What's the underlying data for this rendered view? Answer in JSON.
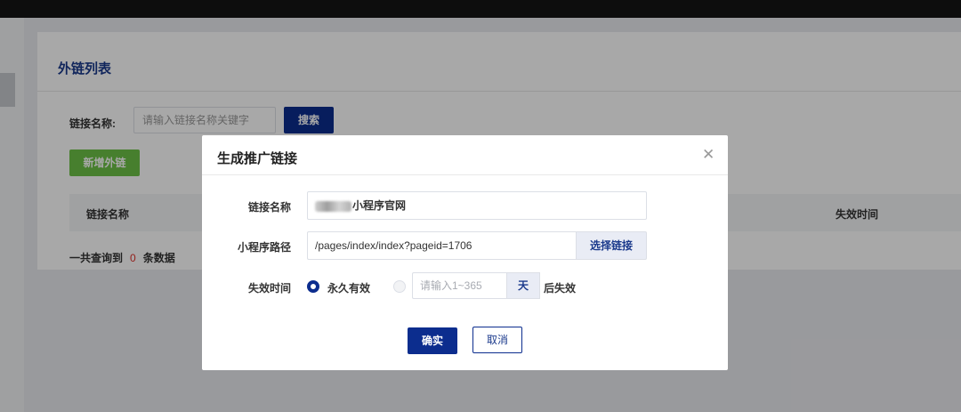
{
  "page": {
    "title": "外链列表",
    "search": {
      "label": "链接名称:",
      "placeholder": "请输入链接名称关键字",
      "button": "搜索"
    },
    "add_button": "新增外链",
    "table": {
      "columns": [
        "链接名称",
        "失效时间"
      ]
    },
    "summary": {
      "prefix": "一共查询到",
      "count": "0",
      "suffix": "条数据"
    }
  },
  "dialog": {
    "title": "生成推广链接",
    "close_icon": "close-icon",
    "name": {
      "label": "链接名称",
      "value_suffix": "小程序官网"
    },
    "path": {
      "label": "小程序路径",
      "value": "/pages/index/index?pageid=1706",
      "button": "选择链接"
    },
    "expiry": {
      "label": "失效时间",
      "option_forever": "永久有效",
      "days_placeholder": "请输入1~365",
      "unit": "天",
      "after": "后失效"
    },
    "confirm": "确实",
    "cancel": "取消"
  },
  "colors": {
    "primary": "#0c2d8e",
    "success": "#6cc147",
    "danger": "#e0312a"
  }
}
